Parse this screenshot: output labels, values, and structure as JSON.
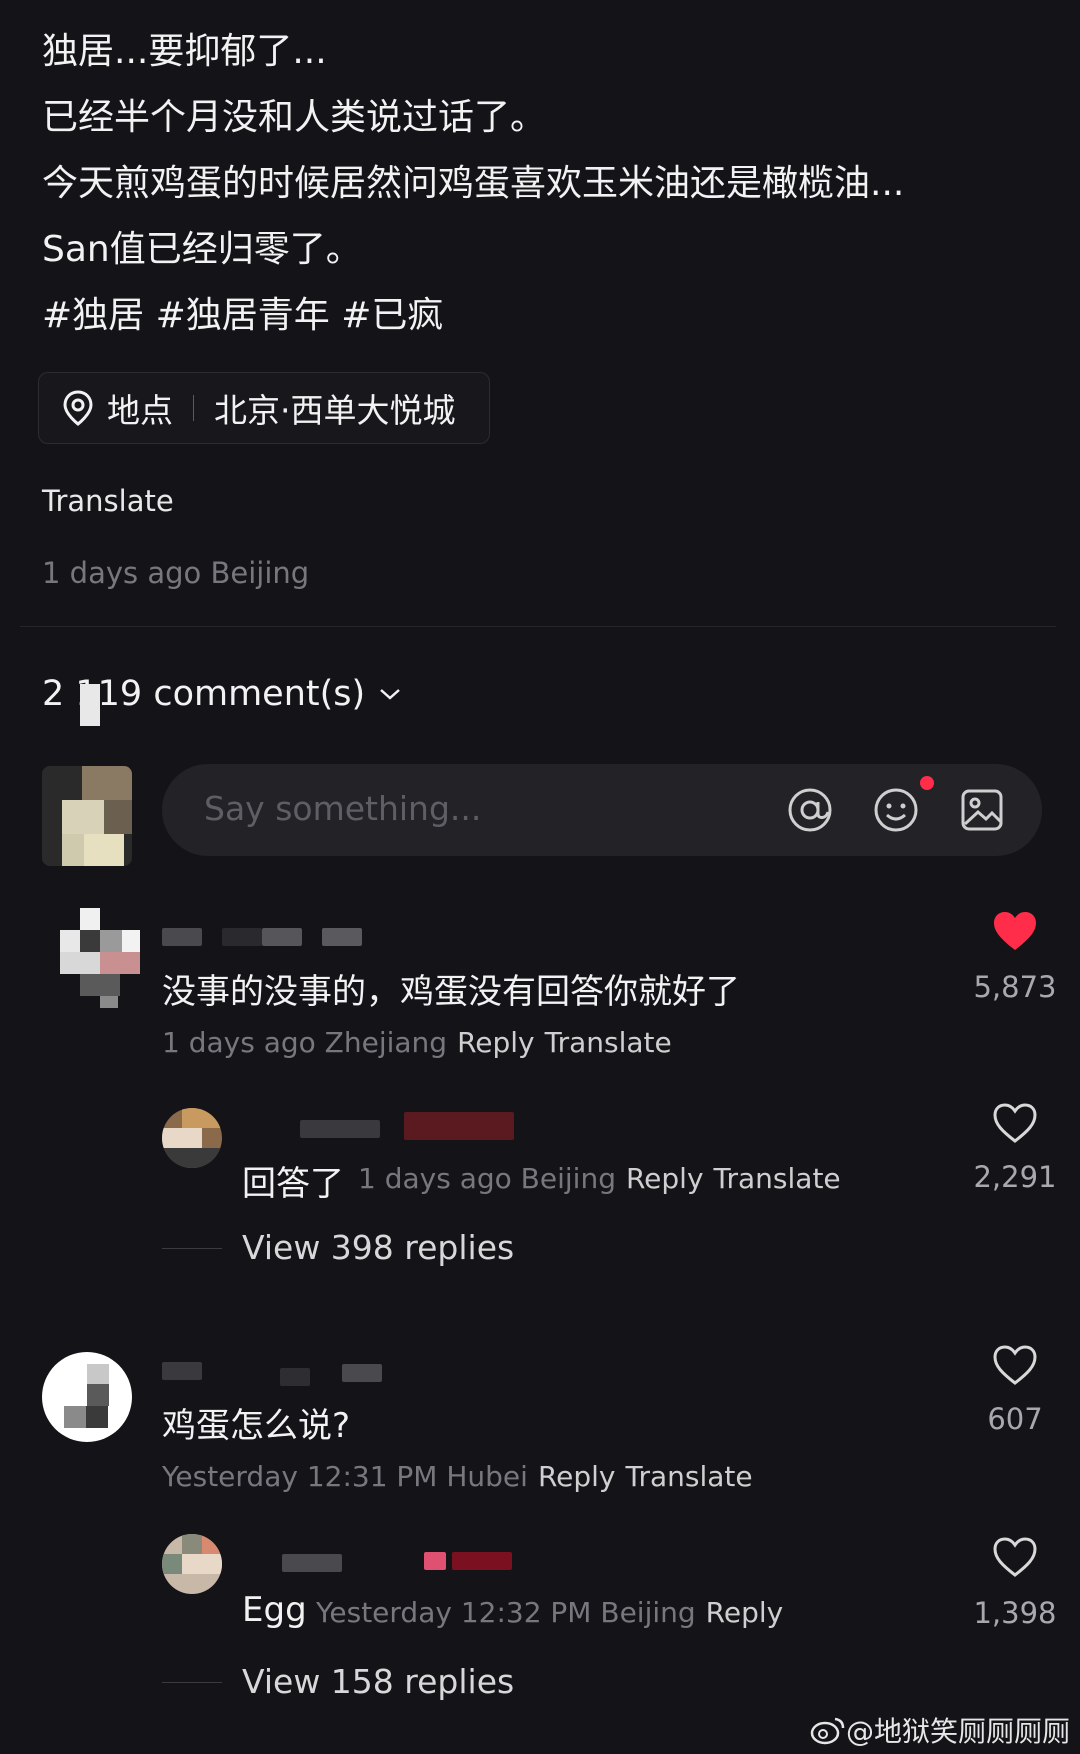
{
  "post": {
    "lines": [
      "独居...要抑郁了...",
      "已经半个月没和人类说过话了。",
      "今天煎鸡蛋的时候居然问鸡蛋喜欢玉米油还是橄榄油...",
      "San值已经归零了。",
      "#独居 #独居青年 #已疯"
    ],
    "location_label": "地点",
    "location_value": "北京·西单大悦城",
    "translate": "Translate",
    "time_location": "1 days ago Beijing"
  },
  "comments_header": {
    "count_label": "2 119 comment(s)"
  },
  "input": {
    "placeholder": "Say something..."
  },
  "comments": [
    {
      "text": "没事的没事的，鸡蛋没有回答你就好了",
      "meta": "1 days ago Zhejiang",
      "reply": "Reply",
      "translate": "Translate",
      "likes": "5,873",
      "liked": true
    },
    {
      "text": "回答了",
      "meta": "1 days ago Beijing",
      "reply": "Reply",
      "translate": "Translate",
      "likes": "2,291",
      "liked": false
    },
    {
      "view_replies": "View 398 replies"
    },
    {
      "text": "鸡蛋怎么说?",
      "meta": "Yesterday 12:31 PM Hubei",
      "reply": "Reply",
      "translate": "Translate",
      "likes": "607",
      "liked": false
    },
    {
      "text": "Egg",
      "meta": "Yesterday 12:32 PM Beijing",
      "reply": "Reply",
      "likes": "1,398",
      "liked": false
    },
    {
      "view_replies": "View 158 replies"
    }
  ],
  "watermark": "@地狱笑厕厕厕厕",
  "colors": {
    "background": "#141418",
    "like_red": "#ff2c4a",
    "meta_gray": "#77777d"
  }
}
